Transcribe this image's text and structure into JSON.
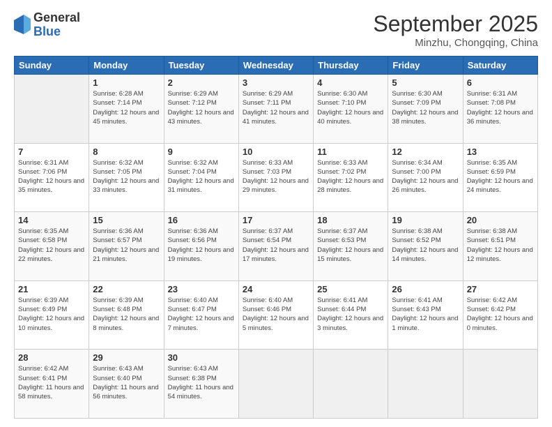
{
  "logo": {
    "general": "General",
    "blue": "Blue"
  },
  "header": {
    "month": "September 2025",
    "location": "Minzhu, Chongqing, China"
  },
  "weekdays": [
    "Sunday",
    "Monday",
    "Tuesday",
    "Wednesday",
    "Thursday",
    "Friday",
    "Saturday"
  ],
  "weeks": [
    [
      {
        "day": "",
        "sunrise": "",
        "sunset": "",
        "daylight": ""
      },
      {
        "day": "1",
        "sunrise": "Sunrise: 6:28 AM",
        "sunset": "Sunset: 7:14 PM",
        "daylight": "Daylight: 12 hours and 45 minutes."
      },
      {
        "day": "2",
        "sunrise": "Sunrise: 6:29 AM",
        "sunset": "Sunset: 7:12 PM",
        "daylight": "Daylight: 12 hours and 43 minutes."
      },
      {
        "day": "3",
        "sunrise": "Sunrise: 6:29 AM",
        "sunset": "Sunset: 7:11 PM",
        "daylight": "Daylight: 12 hours and 41 minutes."
      },
      {
        "day": "4",
        "sunrise": "Sunrise: 6:30 AM",
        "sunset": "Sunset: 7:10 PM",
        "daylight": "Daylight: 12 hours and 40 minutes."
      },
      {
        "day": "5",
        "sunrise": "Sunrise: 6:30 AM",
        "sunset": "Sunset: 7:09 PM",
        "daylight": "Daylight: 12 hours and 38 minutes."
      },
      {
        "day": "6",
        "sunrise": "Sunrise: 6:31 AM",
        "sunset": "Sunset: 7:08 PM",
        "daylight": "Daylight: 12 hours and 36 minutes."
      }
    ],
    [
      {
        "day": "7",
        "sunrise": "Sunrise: 6:31 AM",
        "sunset": "Sunset: 7:06 PM",
        "daylight": "Daylight: 12 hours and 35 minutes."
      },
      {
        "day": "8",
        "sunrise": "Sunrise: 6:32 AM",
        "sunset": "Sunset: 7:05 PM",
        "daylight": "Daylight: 12 hours and 33 minutes."
      },
      {
        "day": "9",
        "sunrise": "Sunrise: 6:32 AM",
        "sunset": "Sunset: 7:04 PM",
        "daylight": "Daylight: 12 hours and 31 minutes."
      },
      {
        "day": "10",
        "sunrise": "Sunrise: 6:33 AM",
        "sunset": "Sunset: 7:03 PM",
        "daylight": "Daylight: 12 hours and 29 minutes."
      },
      {
        "day": "11",
        "sunrise": "Sunrise: 6:33 AM",
        "sunset": "Sunset: 7:02 PM",
        "daylight": "Daylight: 12 hours and 28 minutes."
      },
      {
        "day": "12",
        "sunrise": "Sunrise: 6:34 AM",
        "sunset": "Sunset: 7:00 PM",
        "daylight": "Daylight: 12 hours and 26 minutes."
      },
      {
        "day": "13",
        "sunrise": "Sunrise: 6:35 AM",
        "sunset": "Sunset: 6:59 PM",
        "daylight": "Daylight: 12 hours and 24 minutes."
      }
    ],
    [
      {
        "day": "14",
        "sunrise": "Sunrise: 6:35 AM",
        "sunset": "Sunset: 6:58 PM",
        "daylight": "Daylight: 12 hours and 22 minutes."
      },
      {
        "day": "15",
        "sunrise": "Sunrise: 6:36 AM",
        "sunset": "Sunset: 6:57 PM",
        "daylight": "Daylight: 12 hours and 21 minutes."
      },
      {
        "day": "16",
        "sunrise": "Sunrise: 6:36 AM",
        "sunset": "Sunset: 6:56 PM",
        "daylight": "Daylight: 12 hours and 19 minutes."
      },
      {
        "day": "17",
        "sunrise": "Sunrise: 6:37 AM",
        "sunset": "Sunset: 6:54 PM",
        "daylight": "Daylight: 12 hours and 17 minutes."
      },
      {
        "day": "18",
        "sunrise": "Sunrise: 6:37 AM",
        "sunset": "Sunset: 6:53 PM",
        "daylight": "Daylight: 12 hours and 15 minutes."
      },
      {
        "day": "19",
        "sunrise": "Sunrise: 6:38 AM",
        "sunset": "Sunset: 6:52 PM",
        "daylight": "Daylight: 12 hours and 14 minutes."
      },
      {
        "day": "20",
        "sunrise": "Sunrise: 6:38 AM",
        "sunset": "Sunset: 6:51 PM",
        "daylight": "Daylight: 12 hours and 12 minutes."
      }
    ],
    [
      {
        "day": "21",
        "sunrise": "Sunrise: 6:39 AM",
        "sunset": "Sunset: 6:49 PM",
        "daylight": "Daylight: 12 hours and 10 minutes."
      },
      {
        "day": "22",
        "sunrise": "Sunrise: 6:39 AM",
        "sunset": "Sunset: 6:48 PM",
        "daylight": "Daylight: 12 hours and 8 minutes."
      },
      {
        "day": "23",
        "sunrise": "Sunrise: 6:40 AM",
        "sunset": "Sunset: 6:47 PM",
        "daylight": "Daylight: 12 hours and 7 minutes."
      },
      {
        "day": "24",
        "sunrise": "Sunrise: 6:40 AM",
        "sunset": "Sunset: 6:46 PM",
        "daylight": "Daylight: 12 hours and 5 minutes."
      },
      {
        "day": "25",
        "sunrise": "Sunrise: 6:41 AM",
        "sunset": "Sunset: 6:44 PM",
        "daylight": "Daylight: 12 hours and 3 minutes."
      },
      {
        "day": "26",
        "sunrise": "Sunrise: 6:41 AM",
        "sunset": "Sunset: 6:43 PM",
        "daylight": "Daylight: 12 hours and 1 minute."
      },
      {
        "day": "27",
        "sunrise": "Sunrise: 6:42 AM",
        "sunset": "Sunset: 6:42 PM",
        "daylight": "Daylight: 12 hours and 0 minutes."
      }
    ],
    [
      {
        "day": "28",
        "sunrise": "Sunrise: 6:42 AM",
        "sunset": "Sunset: 6:41 PM",
        "daylight": "Daylight: 11 hours and 58 minutes."
      },
      {
        "day": "29",
        "sunrise": "Sunrise: 6:43 AM",
        "sunset": "Sunset: 6:40 PM",
        "daylight": "Daylight: 11 hours and 56 minutes."
      },
      {
        "day": "30",
        "sunrise": "Sunrise: 6:43 AM",
        "sunset": "Sunset: 6:38 PM",
        "daylight": "Daylight: 11 hours and 54 minutes."
      },
      {
        "day": "",
        "sunrise": "",
        "sunset": "",
        "daylight": ""
      },
      {
        "day": "",
        "sunrise": "",
        "sunset": "",
        "daylight": ""
      },
      {
        "day": "",
        "sunrise": "",
        "sunset": "",
        "daylight": ""
      },
      {
        "day": "",
        "sunrise": "",
        "sunset": "",
        "daylight": ""
      }
    ]
  ]
}
